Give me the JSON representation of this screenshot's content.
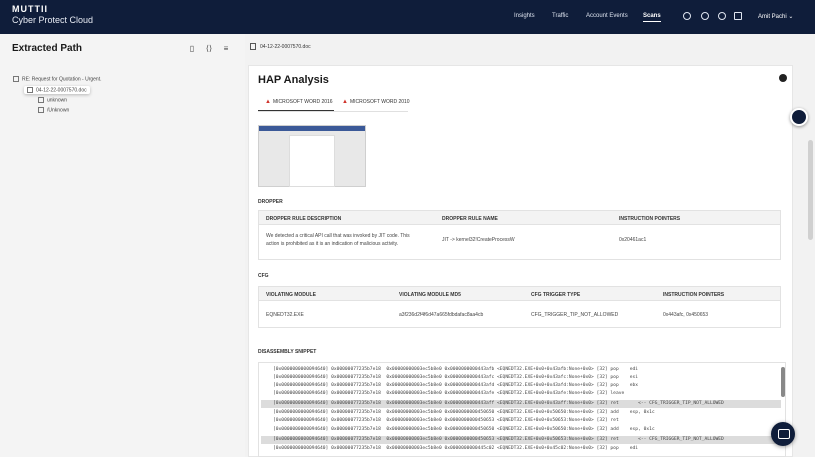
{
  "header": {
    "brand_line1": "MUTTII",
    "brand_line2": "Cyber Protect Cloud",
    "nav": [
      "Insights",
      "Traffic",
      "Account Events",
      "Scans"
    ],
    "active_nav": "Scans",
    "user": "Amit Pachi ⌄",
    "icons": [
      "circle-icon",
      "upload-icon",
      "help-icon",
      "announce-icon"
    ]
  },
  "left": {
    "title": "Extracted Path",
    "toolbar_icons": [
      "document-icon",
      "code-icon",
      "settings-icon"
    ],
    "tree": [
      {
        "label": "RE: Request for Quotation - Urgent.",
        "icon": "email-icon"
      },
      {
        "label": "04-12-22-0007570.doc",
        "icon": "file-icon"
      },
      {
        "label": "unknown",
        "icon": "file-icon"
      },
      {
        "label": "/Unknown",
        "icon": "file-icon"
      }
    ]
  },
  "filebar": {
    "filename": "04-12-22-0007570.doc"
  },
  "analysis": {
    "title": "HAP Analysis",
    "tabs": [
      "MICROSOFT WORD 2016",
      "MICROSOFT WORD 2010"
    ],
    "dropper": {
      "section": "DROPPER",
      "headers": [
        "DROPPER RULE DESCRIPTION",
        "DROPPER RULE NAME",
        "INSTRUCTION POINTERS"
      ],
      "row": {
        "desc_line1": "We detected a critical API call that was invoked by JIT code. This",
        "desc_line2": "action is prohibited as it is an indication of malicious activity.",
        "name": "JIT -> kernel32!CreateProcessW",
        "pointers": "0x20461ac1"
      }
    },
    "cfg": {
      "section": "CFG",
      "headers": [
        "VIOLATING MODULE",
        "VIOLATING MODULE MD5",
        "CFG TRIGGER TYPE",
        "INSTRUCTION POINTERS"
      ],
      "row": {
        "module": "EQNEDT32.EXE",
        "md5": "a3f236d2f4f6d47a665fdbdafac8aa4cb",
        "trigger": "CFG_TRIGGER_TIP_NOT_ALLOWED",
        "pointers": "0x443afc, 0x450653"
      }
    },
    "disasm": {
      "section": "DISASSEMBLY SNIPPET",
      "lines": [
        {
          "text": "[0x0000000000094640] 0x00000077235b7e18  0x00000000003ec5b8e0 0x0000000000443afb <EQNEDT32.EXE+0x0+0x43afb:None+0x0> [32] pop    edi",
          "hl": false
        },
        {
          "text": "[0x0000000000094640] 0x00000077235b7e18  0x00000000003ec5b8e0 0x0000000000443afc <EQNEDT32.EXE+0x0+0x43afc:None+0x0> [32] pop    esi",
          "hl": false
        },
        {
          "text": "[0x0000000000094640] 0x00000077235b7e18  0x00000000003ec5b8e0 0x0000000000443afd <EQNEDT32.EXE+0x0+0x43afd:None+0x0> [32] pop    ebx",
          "hl": false
        },
        {
          "text": "[0x0000000000094640] 0x00000077235b7e18  0x00000000003ec5b8e0 0x0000000000443afe <EQNEDT32.EXE+0x0+0x43afe:None+0x0> [32] leave",
          "hl": false
        },
        {
          "text": "[0x0000000000094640] 0x00000077235b7e18  0x00000000003ec5b8e0 0x0000000000443aff <EQNEDT32.EXE+0x0+0x43aff:None+0x0> [32] ret       <-- CFG_TRIGGER_TIP_NOT_ALLOWED",
          "hl": true
        },
        {
          "text": "[0x0000000000094640] 0x00000077235b7e18  0x00000000003ec5b8e0 0x0000000000450650 <EQNEDT32.EXE+0x0+0x50650:None+0x0> [32] add    esp, 0x1c",
          "hl": false
        },
        {
          "text": "[0x0000000000094640] 0x00000077235b7e18  0x00000000003ec5b8e0 0x0000000000450653 <EQNEDT32.EXE+0x0+0x50653:None+0x0> [32] ret",
          "hl": false
        },
        {
          "text": "[0x0000000000094640] 0x00000077235b7e18  0x00000000003ec5b8e0 0x0000000000450650 <EQNEDT32.EXE+0x0+0x50650:None+0x0> [32] add    esp, 0x1c",
          "hl": false
        },
        {
          "text": "[0x0000000000094640] 0x00000077235b7e18  0x00000000003ec5b8e0 0x0000000000450653 <EQNEDT32.EXE+0x0+0x50653:None+0x0> [32] ret       <-- CFG_TRIGGER_TIP_NOT_ALLOWED",
          "hl": true
        },
        {
          "text": "[0x0000000000094640] 0x00000077235b7e18  0x00000000003ec5b8e0 0x0000000000445c02 <EQNEDT32.EXE+0x0+0x45c02:None+0x0> [32] pop    edi",
          "hl": false
        }
      ]
    }
  }
}
